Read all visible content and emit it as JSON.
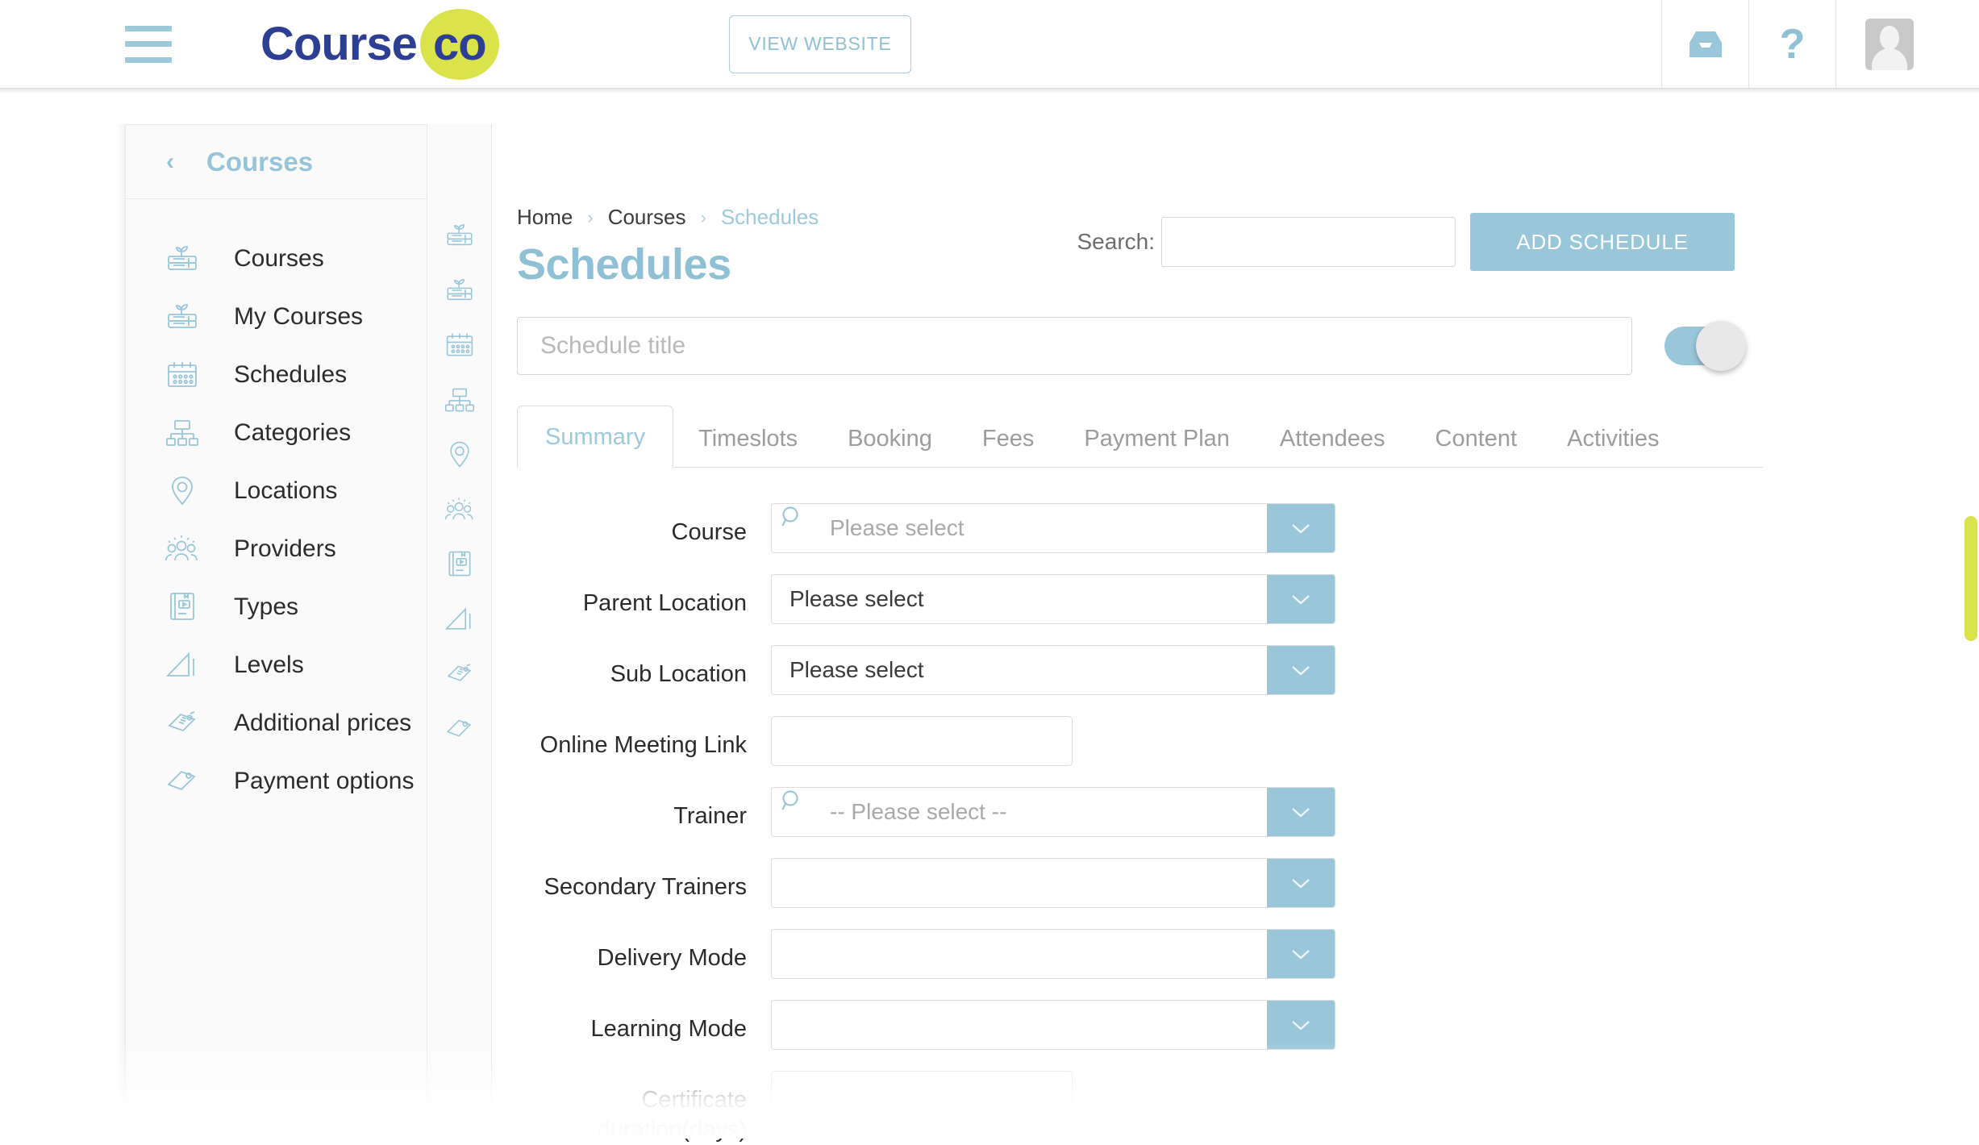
{
  "topbar": {
    "menu_icon": "hamburger-icon",
    "logo_text": "Course",
    "logo_badge_text": "co",
    "view_website_label": "VIEW WEBSITE",
    "inbox_icon": "inbox-icon",
    "help_icon": "?",
    "avatar_icon": "user-avatar-icon"
  },
  "sidebar": {
    "header": {
      "back_icon": "‹",
      "label": "Courses"
    },
    "items": [
      {
        "label": "Courses",
        "icon": "books-plant-icon"
      },
      {
        "label": "My Courses",
        "icon": "books-plant-icon"
      },
      {
        "label": "Schedules",
        "icon": "calendar-icon"
      },
      {
        "label": "Categories",
        "icon": "hierarchy-icon"
      },
      {
        "label": "Locations",
        "icon": "map-pin-icon"
      },
      {
        "label": "Providers",
        "icon": "people-group-icon"
      },
      {
        "label": "Types",
        "icon": "book-video-icon"
      },
      {
        "label": "Levels",
        "icon": "levels-triangle-icon"
      },
      {
        "label": "Additional prices",
        "icon": "price-tag-dollar-icon"
      },
      {
        "label": "Payment options",
        "icon": "tag-icon"
      }
    ]
  },
  "rail": {
    "items": [
      {
        "icon": "books-plant-icon"
      },
      {
        "icon": "books-plant-icon"
      },
      {
        "icon": "calendar-icon"
      },
      {
        "icon": "hierarchy-icon"
      },
      {
        "icon": "map-pin-icon"
      },
      {
        "icon": "people-group-icon"
      },
      {
        "icon": "book-video-icon"
      },
      {
        "icon": "levels-triangle-icon"
      },
      {
        "icon": "price-tag-dollar-icon"
      },
      {
        "icon": "tag-icon"
      }
    ]
  },
  "main": {
    "breadcrumb": {
      "home": "Home",
      "section": "Courses",
      "current": "Schedules",
      "separator": "›"
    },
    "page_title": "Schedules",
    "search": {
      "label": "Search:",
      "value": "",
      "placeholder": ""
    },
    "add_button_label": "ADD SCHEDULE",
    "schedule_title": {
      "value": "",
      "placeholder": "Schedule title"
    },
    "status_toggle": {
      "state": "on"
    },
    "tabs": [
      {
        "label": "Summary",
        "active": true
      },
      {
        "label": "Timeslots",
        "active": false
      },
      {
        "label": "Booking",
        "active": false
      },
      {
        "label": "Fees",
        "active": false
      },
      {
        "label": "Payment Plan",
        "active": false
      },
      {
        "label": "Attendees",
        "active": false
      },
      {
        "label": "Content",
        "active": false
      },
      {
        "label": "Activities",
        "active": false
      }
    ],
    "form": {
      "course": {
        "label": "Course",
        "value": "",
        "placeholder": "Please select",
        "type": "search-select"
      },
      "parent_location": {
        "label": "Parent Location",
        "value": "Please select",
        "type": "select"
      },
      "sub_location": {
        "label": "Sub Location",
        "value": "Please select",
        "type": "select"
      },
      "online_meeting": {
        "label": "Online Meeting Link",
        "value": "",
        "type": "text"
      },
      "trainer": {
        "label": "Trainer",
        "value": "",
        "placeholder": "-- Please select --",
        "type": "search-select"
      },
      "secondary_trainers": {
        "label": "Secondary Trainers",
        "value": "",
        "type": "select"
      },
      "delivery_mode": {
        "label": "Delivery Mode",
        "value": "",
        "type": "select"
      },
      "learning_mode": {
        "label": "Learning Mode",
        "value": "",
        "type": "select"
      },
      "certificate": {
        "label": "Certificate duration(days)",
        "value": "",
        "type": "text"
      }
    }
  },
  "colors": {
    "accent_blue": "#9ac6d9",
    "brand_navy": "#2d3f94",
    "brand_lime": "#dbe34a",
    "scrollbar": "#dbe34a"
  }
}
